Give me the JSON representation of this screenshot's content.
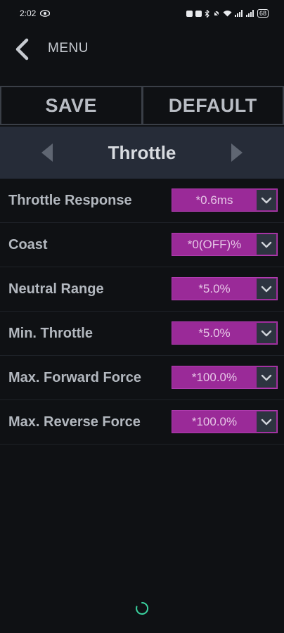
{
  "status_bar": {
    "time": "2:02",
    "battery": "68"
  },
  "header": {
    "back_icon": "chevron-left-icon",
    "menu_label": "MENU"
  },
  "actions": {
    "save_label": "SAVE",
    "default_label": "DEFAULT"
  },
  "pager": {
    "title": "Throttle",
    "prev_icon": "triangle-left-icon",
    "next_icon": "triangle-right-icon"
  },
  "settings": [
    {
      "label": "Throttle Response",
      "value": "*0.6ms"
    },
    {
      "label": "Coast",
      "value": "*0(OFF)%"
    },
    {
      "label": "Neutral Range",
      "value": "*5.0%"
    },
    {
      "label": "Min. Throttle",
      "value": "*5.0%"
    },
    {
      "label": "Max. Forward Force",
      "value": "*100.0%"
    },
    {
      "label": "Max. Reverse Force",
      "value": "*100.0%"
    }
  ],
  "colors": {
    "background": "#0f1114",
    "pager_bg": "#262c38",
    "select_bg": "#9a2a98",
    "spinner": "#3ad29f"
  }
}
